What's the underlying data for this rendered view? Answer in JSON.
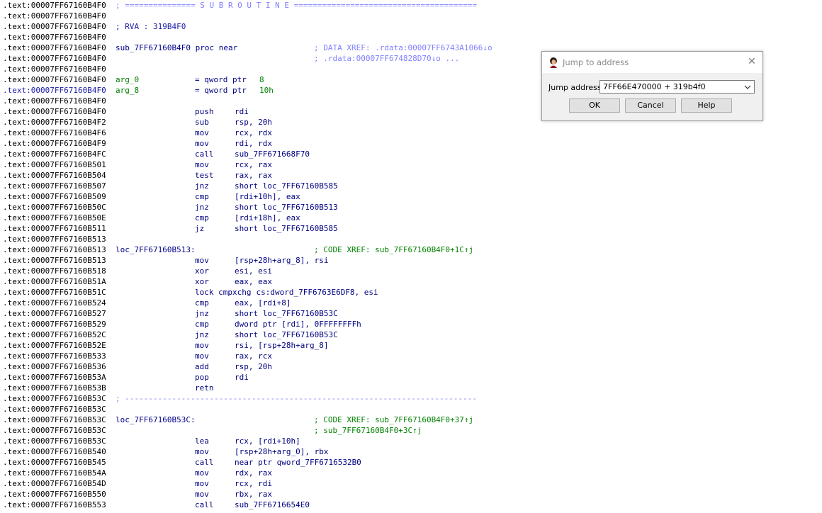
{
  "listing": {
    "lines": [
      {
        "a": ".text:00007FF67160B4F0",
        "t": "sep",
        "c": "; =============== S U B R O U T I N E ======================================="
      },
      {
        "a": ".text:00007FF67160B4F0",
        "t": "blank"
      },
      {
        "a": ".text:00007FF67160B4F0",
        "t": "cmt",
        "c": "; RVA : 319B4F0"
      },
      {
        "a": ".text:00007FF67160B4F0",
        "t": "blank"
      },
      {
        "a": ".text:00007FF67160B4F0",
        "t": "proc",
        "l": "sub_7FF67160B4F0 proc near",
        "c": "; DATA XREF: .rdata:00007FF6743A1066↓o"
      },
      {
        "a": ".text:00007FF67160B4F0",
        "t": "cmtonly",
        "c": "; .rdata:00007FF674828D70↓o ..."
      },
      {
        "a": ".text:00007FF67160B4F0",
        "t": "blank"
      },
      {
        "a": ".text:00007FF67160B4F0",
        "t": "arg",
        "n": "arg_0",
        "e": "= qword ptr",
        "v": "8"
      },
      {
        "a": ".text:00007FF67160B4F0",
        "t": "arg",
        "n": "arg_8",
        "e": "= qword ptr",
        "v": "10h",
        "mark": true
      },
      {
        "a": ".text:00007FF67160B4F0",
        "t": "blank"
      },
      {
        "a": ".text:00007FF67160B4F0",
        "t": "ins",
        "m": "push",
        "o": "rdi"
      },
      {
        "a": ".text:00007FF67160B4F2",
        "t": "ins",
        "m": "sub",
        "o": "rsp, 20h"
      },
      {
        "a": ".text:00007FF67160B4F6",
        "t": "ins",
        "m": "mov",
        "o": "rcx, rdx"
      },
      {
        "a": ".text:00007FF67160B4F9",
        "t": "ins",
        "m": "mov",
        "o": "rdi, rdx"
      },
      {
        "a": ".text:00007FF67160B4FC",
        "t": "ins",
        "m": "call",
        "o": "sub_7FF671668F70"
      },
      {
        "a": ".text:00007FF67160B501",
        "t": "ins",
        "m": "mov",
        "o": "rcx, rax"
      },
      {
        "a": ".text:00007FF67160B504",
        "t": "ins",
        "m": "test",
        "o": "rax, rax"
      },
      {
        "a": ".text:00007FF67160B507",
        "t": "ins",
        "m": "jnz",
        "o": "short loc_7FF67160B585"
      },
      {
        "a": ".text:00007FF67160B509",
        "t": "ins",
        "m": "cmp",
        "o": "[rdi+10h], eax"
      },
      {
        "a": ".text:00007FF67160B50C",
        "t": "ins",
        "m": "jnz",
        "o": "short loc_7FF67160B513"
      },
      {
        "a": ".text:00007FF67160B50E",
        "t": "ins",
        "m": "cmp",
        "o": "[rdi+18h], eax"
      },
      {
        "a": ".text:00007FF67160B511",
        "t": "ins",
        "m": "jz",
        "o": "short loc_7FF67160B585"
      },
      {
        "a": ".text:00007FF67160B513",
        "t": "blank"
      },
      {
        "a": ".text:00007FF67160B513",
        "t": "loc",
        "l": "loc_7FF67160B513:",
        "c": "; CODE XREF: sub_7FF67160B4F0+1C↑j"
      },
      {
        "a": ".text:00007FF67160B513",
        "t": "ins",
        "m": "mov",
        "o": "[rsp+28h+arg_8], rsi"
      },
      {
        "a": ".text:00007FF67160B518",
        "t": "ins",
        "m": "xor",
        "o": "esi, esi"
      },
      {
        "a": ".text:00007FF67160B51A",
        "t": "ins",
        "m": "xor",
        "o": "eax, eax"
      },
      {
        "a": ".text:00007FF67160B51C",
        "t": "ins",
        "m": "lock cmpxchg",
        "o": "cs:dword_7FF6763E6DF8, esi"
      },
      {
        "a": ".text:00007FF67160B524",
        "t": "ins",
        "m": "cmp",
        "o": "eax, [rdi+8]"
      },
      {
        "a": ".text:00007FF67160B527",
        "t": "ins",
        "m": "jnz",
        "o": "short loc_7FF67160B53C"
      },
      {
        "a": ".text:00007FF67160B529",
        "t": "ins",
        "m": "cmp",
        "o": "dword ptr [rdi], 0FFFFFFFFh"
      },
      {
        "a": ".text:00007FF67160B52C",
        "t": "ins",
        "m": "jnz",
        "o": "short loc_7FF67160B53C"
      },
      {
        "a": ".text:00007FF67160B52E",
        "t": "ins",
        "m": "mov",
        "o": "rsi, [rsp+28h+arg_8]"
      },
      {
        "a": ".text:00007FF67160B533",
        "t": "ins",
        "m": "mov",
        "o": "rax, rcx"
      },
      {
        "a": ".text:00007FF67160B536",
        "t": "ins",
        "m": "add",
        "o": "rsp, 20h"
      },
      {
        "a": ".text:00007FF67160B53A",
        "t": "ins",
        "m": "pop",
        "o": "rdi"
      },
      {
        "a": ".text:00007FF67160B53B",
        "t": "ins",
        "m": "retn",
        "o": ""
      },
      {
        "a": ".text:00007FF67160B53C",
        "t": "sep",
        "c": "; ---------------------------------------------------------------------------"
      },
      {
        "a": ".text:00007FF67160B53C",
        "t": "blank"
      },
      {
        "a": ".text:00007FF67160B53C",
        "t": "loc",
        "l": "loc_7FF67160B53C:",
        "c": "; CODE XREF: sub_7FF67160B4F0+37↑j"
      },
      {
        "a": ".text:00007FF67160B53C",
        "t": "cmtonly",
        "c": "; sub_7FF67160B4F0+3C↑j",
        "green": true
      },
      {
        "a": ".text:00007FF67160B53C",
        "t": "ins",
        "m": "lea",
        "o": "rcx, [rdi+10h]"
      },
      {
        "a": ".text:00007FF67160B540",
        "t": "ins",
        "m": "mov",
        "o": "[rsp+28h+arg_0], rbx"
      },
      {
        "a": ".text:00007FF67160B545",
        "t": "ins",
        "m": "call",
        "o": "near ptr qword_7FF6716532B0"
      },
      {
        "a": ".text:00007FF67160B54A",
        "t": "ins",
        "m": "mov",
        "o": "rdx, rax"
      },
      {
        "a": ".text:00007FF67160B54D",
        "t": "ins",
        "m": "mov",
        "o": "rcx, rdi"
      },
      {
        "a": ".text:00007FF67160B550",
        "t": "ins",
        "m": "mov",
        "o": "rbx, rax"
      },
      {
        "a": ".text:00007FF67160B553",
        "t": "ins",
        "m": "call",
        "o": "sub_7FF6716654E0"
      }
    ]
  },
  "dialog": {
    "title": "Jump to address",
    "close_icon": "close-icon",
    "app_icon": "ida-avatar-icon",
    "field_label_hotkey": "J",
    "field_label_rest": "ump address",
    "field_value": "7FF66E470000 + 319b4f0",
    "ok_label": "OK",
    "cancel_label": "Cancel",
    "help_label": "Help"
  }
}
